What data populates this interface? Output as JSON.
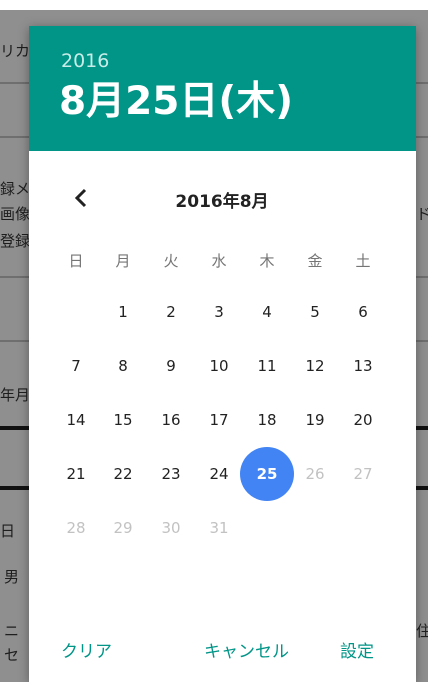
{
  "background": {
    "fragments": [
      "リカ",
      "録メ",
      "画像",
      "登録",
      "ド",
      "年月",
      "日",
      "男",
      "ニ",
      "セ",
      "住"
    ]
  },
  "colors": {
    "header": "#009587",
    "accent": "#009587",
    "selected": "#4284f3"
  },
  "datepicker": {
    "header_year": "2016",
    "header_date": "8月25日(木)",
    "nav_prev_icon": "chevron-left-icon",
    "month_title": "2016年8月",
    "weekdays": [
      "日",
      "月",
      "火",
      "水",
      "木",
      "金",
      "土"
    ],
    "start_weekday": 1,
    "days": [
      "1",
      "2",
      "3",
      "4",
      "5",
      "6",
      "7",
      "8",
      "9",
      "10",
      "11",
      "12",
      "13",
      "14",
      "15",
      "16",
      "17",
      "18",
      "19",
      "20",
      "21",
      "22",
      "23",
      "24",
      "25",
      "26",
      "27",
      "28",
      "29",
      "30",
      "31"
    ],
    "selected_day": "25",
    "enabled_through": 25
  },
  "buttons": {
    "clear": "クリア",
    "cancel": "キャンセル",
    "set": "設定"
  }
}
